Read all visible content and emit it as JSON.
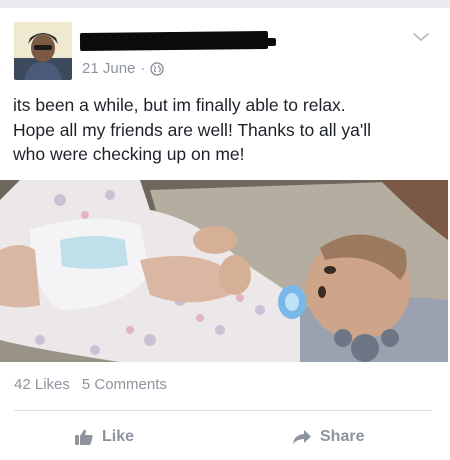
{
  "post": {
    "date": "21 June",
    "separator": "·",
    "privacy_icon": "globe-icon",
    "text_lines": [
      "its been a while, but im finally able to relax.",
      "Hope all my friends are well! Thanks to all ya'll",
      "who were checking up on me!"
    ]
  },
  "stats": {
    "likes": "42 Likes",
    "comments": "5 Comments"
  },
  "actions": {
    "like_label": "Like",
    "share_label": "Share"
  },
  "colors": {
    "meta_gray": "#8d949e",
    "text": "#1d2129",
    "divider": "#dadde1",
    "avatar_bg": "#e7e2cf"
  }
}
